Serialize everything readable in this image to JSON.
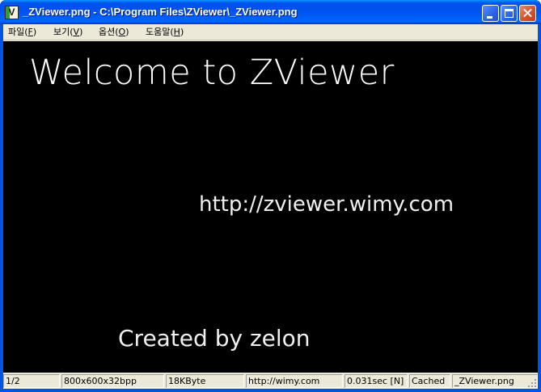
{
  "window": {
    "title": "_ZViewer.png - C:\\Program Files\\ZViewer\\_ZViewer.png",
    "app_icon_letter": "V",
    "buttons": [
      "minimize-icon",
      "maximize-icon",
      "close-icon"
    ]
  },
  "menu": {
    "items": [
      {
        "label": "파일(",
        "mnemonic": "F",
        "tail": ")"
      },
      {
        "label": "보기(",
        "mnemonic": "V",
        "tail": ")"
      },
      {
        "label": "옵션(",
        "mnemonic": "O",
        "tail": ")"
      },
      {
        "label": "도움말(",
        "mnemonic": "H",
        "tail": ")"
      }
    ]
  },
  "image": {
    "welcome": "Welcome to ZViewer",
    "url": "http://zviewer.wimy.com",
    "credit": "Created by zelon",
    "background": "#000000",
    "text_color": "#ffffff"
  },
  "status": {
    "index": "1/2",
    "dimensions": "800x600x32bpp",
    "filesize": "18KByte",
    "site": "http://wimy.com",
    "timing": "0.031sec [N]",
    "cache": "Cached",
    "filename": "_ZViewer.png"
  },
  "colors": {
    "titlebar": "#0055e5",
    "close_button": "#d4512b",
    "menubar": "#ece9d8"
  }
}
